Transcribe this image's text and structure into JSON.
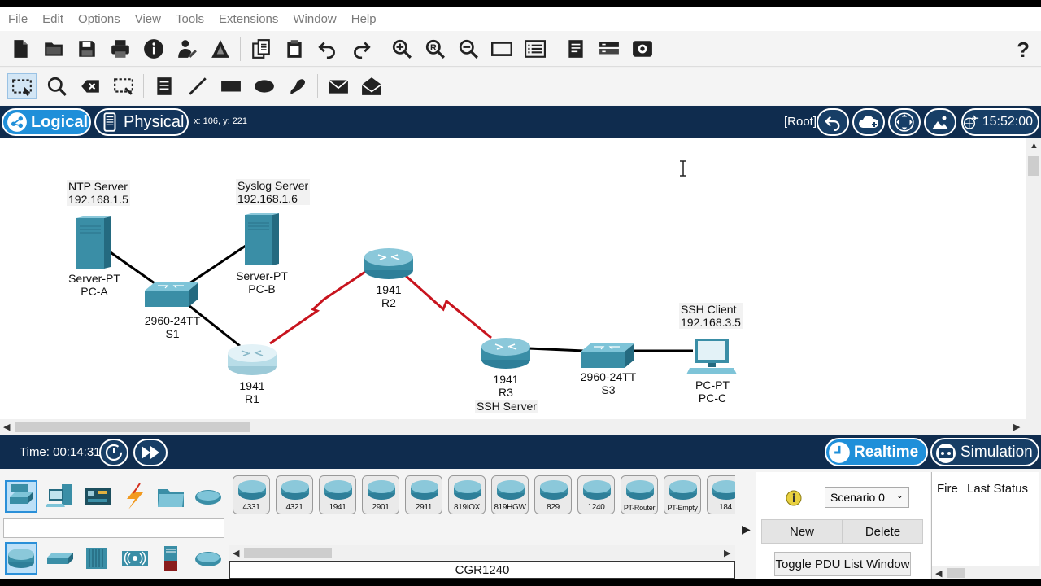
{
  "menu": {
    "file": "File",
    "edit": "Edit",
    "options": "Options",
    "view": "View",
    "tools": "Tools",
    "extensions": "Extensions",
    "window": "Window",
    "help": "Help"
  },
  "toolbar": {
    "help": "?"
  },
  "workspace": {
    "logical_label": "Logical",
    "physical_label": "Physical",
    "coords": "x: 106, y: 221",
    "root_label": "[Root]",
    "clock": "15:52:00"
  },
  "topology": {
    "ntp": {
      "title": "NTP Server",
      "ip": "192.168.1.5",
      "model": "Server-PT",
      "name": "PC-A"
    },
    "syslog": {
      "title": "Syslog Server",
      "ip": "192.168.1.6",
      "model": "Server-PT",
      "name": "PC-B"
    },
    "s1": {
      "model": "2960-24TT",
      "name": "S1"
    },
    "r1": {
      "model": "1941",
      "name": "R1"
    },
    "r2": {
      "model": "1941",
      "name": "R2"
    },
    "r3": {
      "model": "1941",
      "name": "R3",
      "role": "SSH Server"
    },
    "s3": {
      "model": "2960-24TT",
      "name": "S3"
    },
    "pcc": {
      "title": "SSH Client",
      "ip": "192.168.3.5",
      "model": "PC-PT",
      "name": "PC-C"
    },
    "colors": {
      "ethernet": "#000000",
      "serial": "#c8141e"
    }
  },
  "timebar": {
    "time": "Time: 00:14:31",
    "realtime": "Realtime",
    "simulation": "Simulation"
  },
  "devices": {
    "items": [
      "4331",
      "4321",
      "1941",
      "2901",
      "2911",
      "819IOX",
      "819HGW",
      "829",
      "1240",
      "PT-Router",
      "PT-Empty",
      "184"
    ],
    "selected_name": "CGR1240"
  },
  "pdu": {
    "scenario": "Scenario 0",
    "new": "New",
    "delete": "Delete",
    "toggle": "Toggle PDU List Window",
    "col_fire": "Fire",
    "col_status": "Last Status"
  }
}
